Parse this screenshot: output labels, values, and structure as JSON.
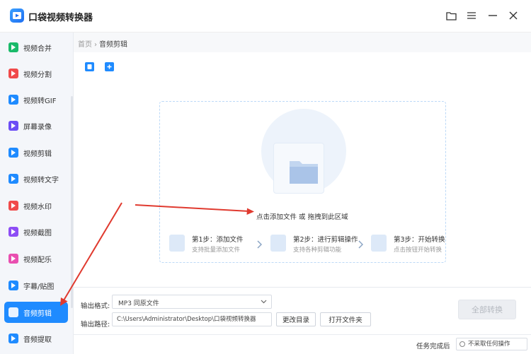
{
  "app": {
    "title": "口袋视频转换器"
  },
  "window_controls": [
    "folder-icon",
    "menu-icon",
    "minimize-icon",
    "close-icon"
  ],
  "sidebar": {
    "items": [
      {
        "label": "视频合并",
        "icon": "video-merge-icon",
        "color": "#1aba6a",
        "active": false
      },
      {
        "label": "视频分割",
        "icon": "video-split-icon",
        "color": "#f04a4a",
        "active": false
      },
      {
        "label": "视频转GIF",
        "icon": "video-gif-icon",
        "color": "#1f8bff",
        "active": false
      },
      {
        "label": "屏幕录像",
        "icon": "screen-record-icon",
        "color": "#6c4df5",
        "active": false
      },
      {
        "label": "视频剪辑",
        "icon": "video-edit-icon",
        "color": "#1f8bff",
        "active": false
      },
      {
        "label": "视频转文字",
        "icon": "video-text-icon",
        "color": "#1f8bff",
        "active": false
      },
      {
        "label": "视频水印",
        "icon": "video-watermark-icon",
        "color": "#f04a4a",
        "active": false
      },
      {
        "label": "视频截图",
        "icon": "video-screenshot-icon",
        "color": "#8d4df5",
        "active": false
      },
      {
        "label": "视频配乐",
        "icon": "video-music-icon",
        "color": "#e94fb0",
        "active": false
      },
      {
        "label": "字幕/贴图",
        "icon": "subtitle-icon",
        "color": "#1f8bff",
        "active": false
      },
      {
        "label": "音频剪辑",
        "icon": "audio-edit-icon",
        "color": "#1f8bff",
        "active": true
      },
      {
        "label": "音频提取",
        "icon": "audio-extract-icon",
        "color": "#1f8bff",
        "active": false
      }
    ]
  },
  "breadcrumb": {
    "home": "首页",
    "separator": "›",
    "current": "音频剪辑"
  },
  "toolbar": {
    "add_file_icon": "add-file-icon",
    "add_folder_icon": "add-folder-icon"
  },
  "dropzone": {
    "prompt_main": "点击添加文件",
    "prompt_or": "或",
    "prompt_drag": "拖拽到此区域"
  },
  "steps": [
    {
      "title": "第1步：添加文件",
      "subtitle": "支持批量添加文件"
    },
    {
      "title": "第2步：进行剪辑操作",
      "subtitle": "支持各种剪辑功能"
    },
    {
      "title": "第3步：开始转换",
      "subtitle": "点击按钮开始转换"
    }
  ],
  "output": {
    "format_label": "输出格式:",
    "format_value": "MP3  同原文件",
    "path_label": "输出路径:",
    "path_value": "C:\\Users\\Administrator\\Desktop\\口袋视频转换器",
    "change_dir_label": "更改目录",
    "open_folder_label": "打开文件夹",
    "convert_all_label": "全部转换"
  },
  "footer": {
    "after_task_label": "任务完成后",
    "after_task_value": "不采取任何操作"
  },
  "colors": {
    "accent": "#1f8bff",
    "annotation_arrow": "#e03a2f"
  }
}
